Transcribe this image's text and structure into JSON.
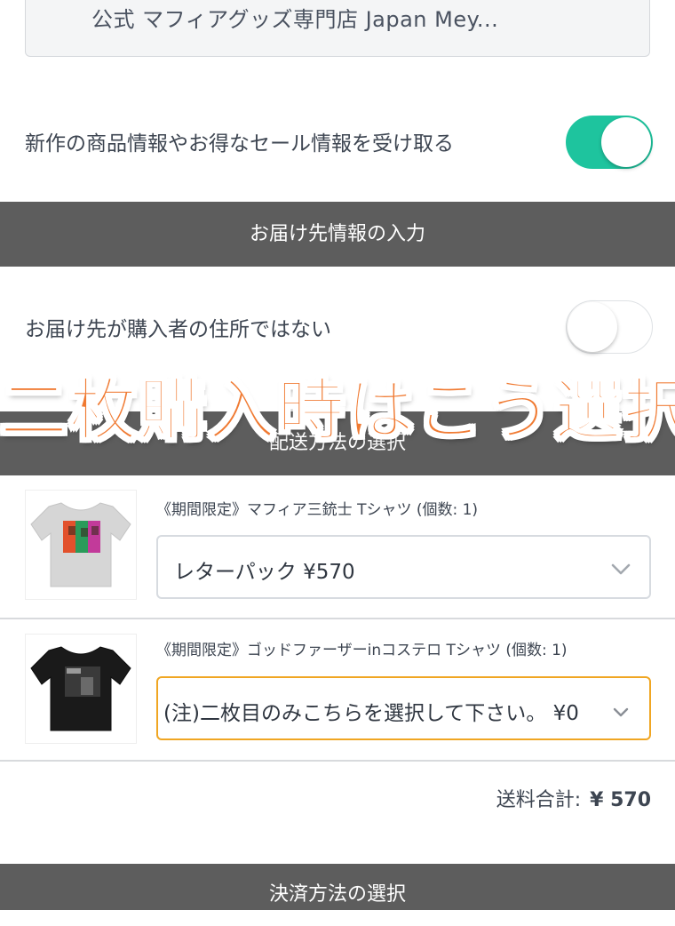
{
  "shop": {
    "name": "公式 マフィアグッズ専門店 Japan Mey..."
  },
  "newsletter": {
    "label": "新作の商品情報やお得なセール情報を受け取る",
    "enabled": true
  },
  "sections": {
    "delivery_info": "お届け先情報の入力",
    "shipping_method": "配送方法の選択",
    "payment_method": "決済方法の選択"
  },
  "recipient": {
    "label": "お届け先が購入者の住所ではない",
    "enabled": false
  },
  "overlay": {
    "text": "二枚購入時はこう選択"
  },
  "items": [
    {
      "title": "《期間限定》マフィア三銃士 Tシャツ (個数: 1)",
      "shipping_selected": "レターパック ¥570",
      "shirt_color": "#d6d6d6"
    },
    {
      "title": "《期間限定》ゴッドファーザーinコステロ Tシャツ (個数: 1)",
      "shipping_selected": "(注)二枚目のみこちらを選択して下さい。 ¥0",
      "shirt_color": "#1a1a1a"
    }
  ],
  "shipping_total": {
    "label": "送料合計:",
    "amount": "¥ 570"
  },
  "colors": {
    "accent": "#1ec49e",
    "section_bar": "#5d5d5d",
    "overlay_orange": "#f07a32",
    "focus_border": "#f0a623"
  }
}
